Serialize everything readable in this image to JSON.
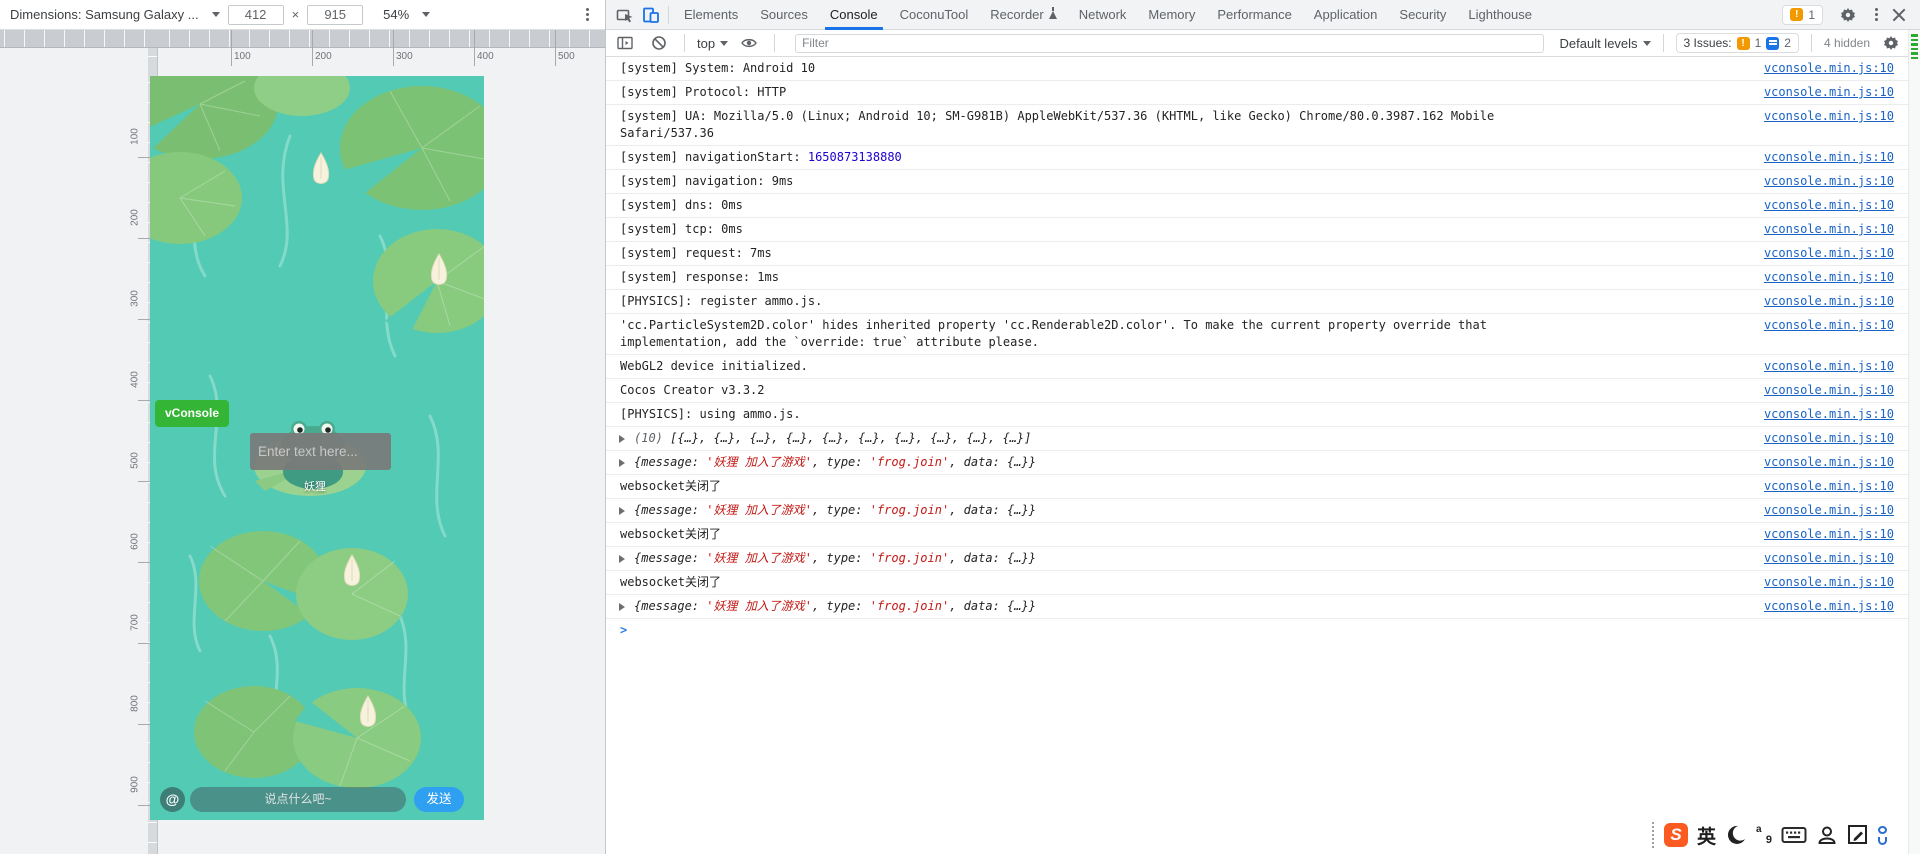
{
  "device_toolbar": {
    "dimensions_label": "Dimensions: Samsung Galaxy ...",
    "width": "412",
    "height": "915",
    "times": "×",
    "zoom": "54%"
  },
  "rulers": {
    "horizontal": [
      "100",
      "200",
      "300",
      "400",
      "500"
    ],
    "vertical": [
      "100",
      "200",
      "300",
      "400",
      "500",
      "600",
      "700",
      "800",
      "900"
    ]
  },
  "game": {
    "vconsole_label": "vConsole",
    "text_input_placeholder": "Enter text here...",
    "player_name": "妖狸",
    "at_symbol": "@",
    "chat_placeholder": "说点什么吧~",
    "send_label": "发送"
  },
  "devtools": {
    "tabs": [
      {
        "label": "Elements"
      },
      {
        "label": "Sources"
      },
      {
        "label": "Console",
        "active": true
      },
      {
        "label": "CoconuTool"
      },
      {
        "label": "Recorder",
        "flask": true
      },
      {
        "label": "Network"
      },
      {
        "label": "Memory"
      },
      {
        "label": "Performance"
      },
      {
        "label": "Application"
      },
      {
        "label": "Security"
      },
      {
        "label": "Lighthouse"
      }
    ],
    "warning_badge": "1",
    "console_toolbar": {
      "context_label": "top",
      "filter_placeholder": "Filter",
      "default_levels_label": "Default levels",
      "issues_label": "3 Issues:",
      "issues_error_count": "1",
      "issues_info_count": "2",
      "hidden_label": "4 hidden"
    }
  },
  "console": {
    "prompt_symbol": ">",
    "rows": [
      {
        "kind": "log",
        "text": "[system] System: Android 10",
        "link": "vconsole.min.js:10"
      },
      {
        "kind": "log",
        "text": "[system] Protocol: HTTP",
        "link": "vconsole.min.js:10"
      },
      {
        "kind": "log",
        "text": "[system] UA: Mozilla/5.0 (Linux; Android 10; SM-G981B) AppleWebKit/537.36 (KHTML, like Gecko) Chrome/80.0.3987.162 Mobile Safari/537.36",
        "link": "vconsole.min.js:10"
      },
      {
        "kind": "parts",
        "parts": [
          {
            "text": "[system] navigationStart: "
          },
          {
            "text": "1650873138880",
            "style": "number"
          }
        ],
        "link": "vconsole.min.js:10"
      },
      {
        "kind": "log",
        "text": "[system] navigation: 9ms",
        "link": "vconsole.min.js:10"
      },
      {
        "kind": "log",
        "text": "[system] dns: 0ms",
        "link": "vconsole.min.js:10"
      },
      {
        "kind": "log",
        "text": "[system] tcp: 0ms",
        "link": "vconsole.min.js:10"
      },
      {
        "kind": "log",
        "text": "[system] request: 7ms",
        "link": "vconsole.min.js:10"
      },
      {
        "kind": "log",
        "text": "[system] response: 1ms",
        "link": "vconsole.min.js:10"
      },
      {
        "kind": "log",
        "text": "[PHYSICS]: register ammo.js.",
        "link": "vconsole.min.js:10"
      },
      {
        "kind": "log",
        "text": "'cc.ParticleSystem2D.color' hides inherited property 'cc.Renderable2D.color'. To make the current property override that implementation, add the `override: true` attribute please.",
        "link": "vconsole.min.js:10"
      },
      {
        "kind": "log",
        "text": "WebGL2 device initialized.",
        "link": "vconsole.min.js:10"
      },
      {
        "kind": "log",
        "text": "Cocos Creator v3.3.2",
        "link": "vconsole.min.js:10"
      },
      {
        "kind": "log",
        "text": "[PHYSICS]: using ammo.js.",
        "link": "vconsole.min.js:10"
      },
      {
        "kind": "parts",
        "expandable": true,
        "italic": true,
        "parts": [
          {
            "text": "(10) ",
            "style": "dim"
          },
          {
            "text": "[{…}, {…}, {…}, {…}, {…}, {…}, {…}, {…}, {…}, {…}]"
          }
        ],
        "link": "vconsole.min.js:10"
      },
      {
        "kind": "parts",
        "expandable": true,
        "italic": true,
        "parts": [
          {
            "text": "{message: "
          },
          {
            "text": "'妖狸 加入了游戏'",
            "style": "string"
          },
          {
            "text": ", type: "
          },
          {
            "text": "'frog.join'",
            "style": "string"
          },
          {
            "text": ", data: {…}}"
          }
        ],
        "link": "vconsole.min.js:10"
      },
      {
        "kind": "log",
        "text": "websocket关闭了",
        "link": "vconsole.min.js:10"
      },
      {
        "kind": "parts",
        "expandable": true,
        "italic": true,
        "parts": [
          {
            "text": "{message: "
          },
          {
            "text": "'妖狸 加入了游戏'",
            "style": "string"
          },
          {
            "text": ", type: "
          },
          {
            "text": "'frog.join'",
            "style": "string"
          },
          {
            "text": ", data: {…}}"
          }
        ],
        "link": "vconsole.min.js:10"
      },
      {
        "kind": "log",
        "text": "websocket关闭了",
        "link": "vconsole.min.js:10"
      },
      {
        "kind": "parts",
        "expandable": true,
        "italic": true,
        "parts": [
          {
            "text": "{message: "
          },
          {
            "text": "'妖狸 加入了游戏'",
            "style": "string"
          },
          {
            "text": ", type: "
          },
          {
            "text": "'frog.join'",
            "style": "string"
          },
          {
            "text": ", data: {…}}"
          }
        ],
        "link": "vconsole.min.js:10"
      },
      {
        "kind": "log",
        "text": "websocket关闭了",
        "link": "vconsole.min.js:10"
      },
      {
        "kind": "parts",
        "expandable": true,
        "italic": true,
        "parts": [
          {
            "text": "{message: "
          },
          {
            "text": "'妖狸 加入了游戏'",
            "style": "string"
          },
          {
            "text": ", type: "
          },
          {
            "text": "'frog.join'",
            "style": "string"
          },
          {
            "text": ", data: {…}}"
          }
        ],
        "link": "vconsole.min.js:10"
      },
      {
        "kind": "prompt"
      }
    ]
  },
  "tray": {
    "ying_label": "英",
    "icons": [
      "drag-handle",
      "sogou-input",
      "english-mode",
      "crescent-mode",
      "input-state",
      "soft-keyboard",
      "contacts",
      "edit-settings",
      "clipped-icon"
    ]
  },
  "colors": {
    "accent": "#1a73e8",
    "link": "#1b62c5",
    "string_red": "#c41a16",
    "number_blue": "#1c00cf",
    "vconsole_green": "#35b535",
    "send_blue": "#2f9ff2",
    "water": "#52cab4",
    "badge_orange": "#f29900",
    "scroll_green": "#2faa33"
  }
}
